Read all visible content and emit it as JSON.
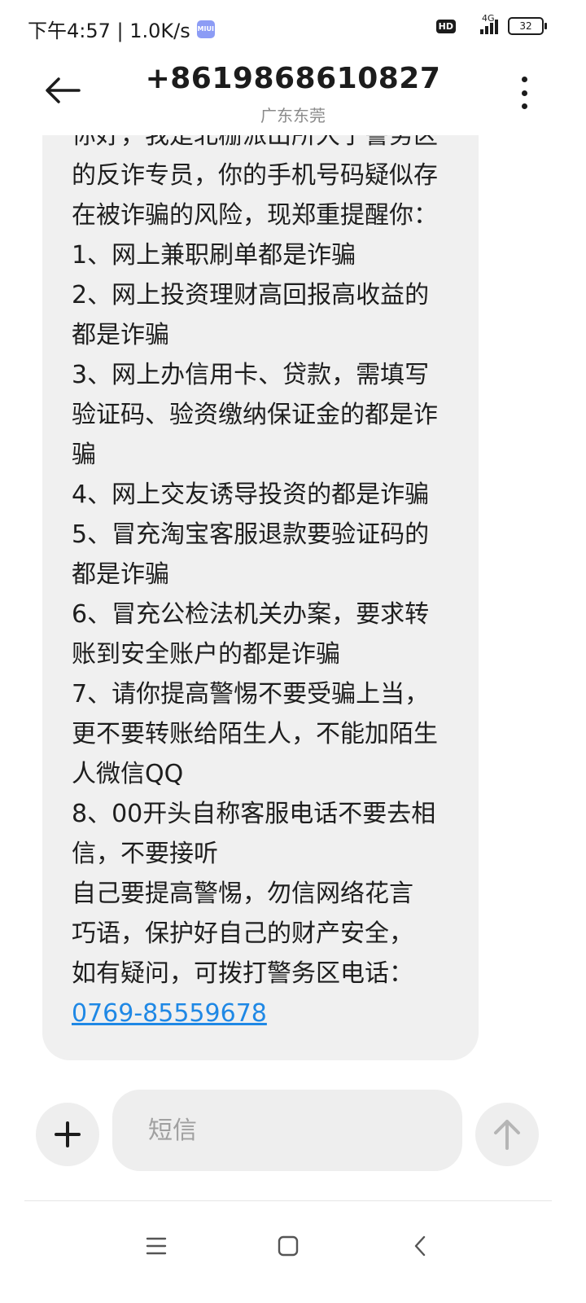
{
  "status_bar": {
    "time_speed": "下午4:57 | 1.0K/s",
    "miui_badge": "MIUI",
    "hd": "HD",
    "network": "4G",
    "battery": "32"
  },
  "header": {
    "title": "+8619868610827",
    "subtitle": "广东东莞"
  },
  "message": {
    "lines": [
      "你好，我是北栅派出所大宁警务区",
      "的反诈专员，你的手机号码疑似存",
      "在被诈骗的风险，现郑重提醒你：",
      "1、网上兼职刷单都是诈骗",
      "2、网上投资理财高回报高收益的",
      "都是诈骗",
      "3、网上办信用卡、贷款，需填写",
      "验证码、验资缴纳保证金的都是诈",
      "骗",
      "4、网上交友诱导投资的都是诈骗",
      "5、冒充淘宝客服退款要验证码的",
      "都是诈骗",
      "6、冒充公检法机关办案，要求转",
      "账到安全账户的都是诈骗",
      "7、请你提高警惕不要受骗上当，",
      "更不要转账给陌生人，不能加陌生",
      "人微信QQ",
      "8、00开头自称客服电话不要去相",
      "信，不要接听",
      "自己要提高警惕，勿信网络花言",
      "巧语，保护好自己的财产安全，",
      "如有疑问，可拨打警务区电话："
    ],
    "phone_link": "0769-85559678"
  },
  "input": {
    "placeholder": "短信"
  },
  "icons": {
    "back": "back-arrow-icon",
    "more": "more-vertical-icon",
    "add": "plus-icon",
    "send": "send-arrow-up-icon",
    "nav_menu": "menu-icon",
    "nav_home": "home-square-icon",
    "nav_back": "back-chevron-icon"
  },
  "colors": {
    "link": "#1f88e5",
    "bubble": "#f0f0f0",
    "input_bg": "#eeeeee"
  }
}
